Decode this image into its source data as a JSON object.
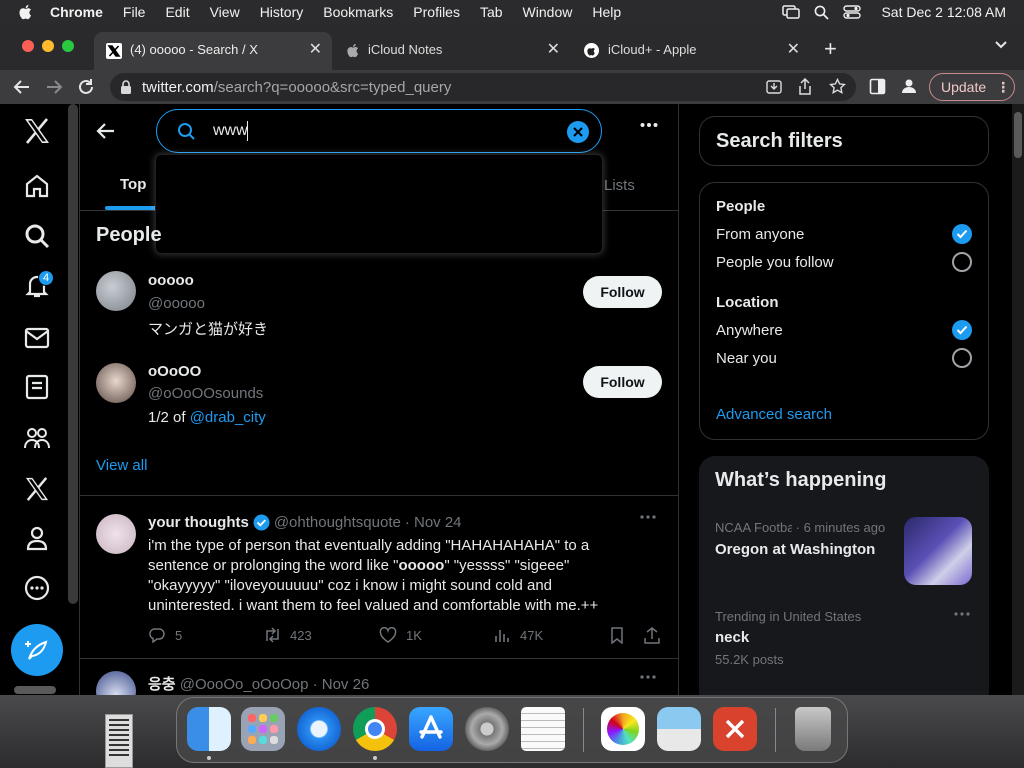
{
  "menubar": {
    "app_name": "Chrome",
    "items": [
      "File",
      "Edit",
      "View",
      "History",
      "Bookmarks",
      "Profiles",
      "Tab",
      "Window",
      "Help"
    ],
    "datetime": "Sat Dec 2  12:08 AM"
  },
  "tabs": [
    {
      "title": "(4) ooooo - Search / X"
    },
    {
      "title": "iCloud Notes"
    },
    {
      "title": "iCloud+ - Apple"
    }
  ],
  "toolbar": {
    "url_host": "twitter.com",
    "url_path": "/search?q=ooooo&src=typed_query",
    "update_label": "Update"
  },
  "sidebar": {
    "notification_count": "4",
    "items": [
      "X",
      "Home",
      "Explore",
      "Notifications",
      "Messages",
      "Lists",
      "Communities",
      "Premium",
      "Profile",
      "More",
      "Post"
    ]
  },
  "search": {
    "query": "www",
    "tab_top": "Top",
    "tab_lists": "Lists"
  },
  "people": {
    "heading": "People",
    "users": [
      {
        "name": "ooooo",
        "handle": "@ooooo",
        "bio": "マンガと猫が好き",
        "follow_label": "Follow"
      },
      {
        "name": "oOoOO",
        "handle": "@oOoOOsounds",
        "bio_prefix": "1/2 of ",
        "bio_link": "@drab_city",
        "follow_label": "Follow"
      }
    ],
    "view_all": "View all"
  },
  "tweets": [
    {
      "name": "your thoughts",
      "handle": "@ohthoughtsquote",
      "date": "· Nov 24",
      "text_lines": [
        "i'm the type of person that eventually adding \"HAHAHAHAHA\" to a",
        "sentence or prolonging the word like \"",
        "\" \"yessss\" \"sigeee\"",
        "\"okayyyyy\" \"iloveyouuuuu\" coz i know i might sound cold and",
        "uninterested. i want them to feel valued and comfortable with me.++"
      ],
      "bold_word": "ooooo",
      "replies": "5",
      "retweets": "423",
      "likes": "1K",
      "views": "47K"
    },
    {
      "name": "응충",
      "handle": "@OooOo_oOoOop",
      "date": "· Nov 26"
    }
  ],
  "filters": {
    "title": "Search filters",
    "people_heading": "People",
    "from_anyone": "From anyone",
    "people_you_follow": "People you follow",
    "location_heading": "Location",
    "anywhere": "Anywhere",
    "near_you": "Near you",
    "advanced_search": "Advanced search"
  },
  "happening": {
    "title": "What’s happening",
    "items": [
      {
        "context": "NCAA Footba",
        "time": "· 6 minutes ago",
        "headline": "Oregon at Washington"
      },
      {
        "context": "Trending in United States",
        "headline": "neck",
        "posts": "55.2K posts"
      }
    ]
  },
  "colors": {
    "accent": "#1d9bf0",
    "background": "#000000",
    "update_border": "#c98a8a"
  }
}
